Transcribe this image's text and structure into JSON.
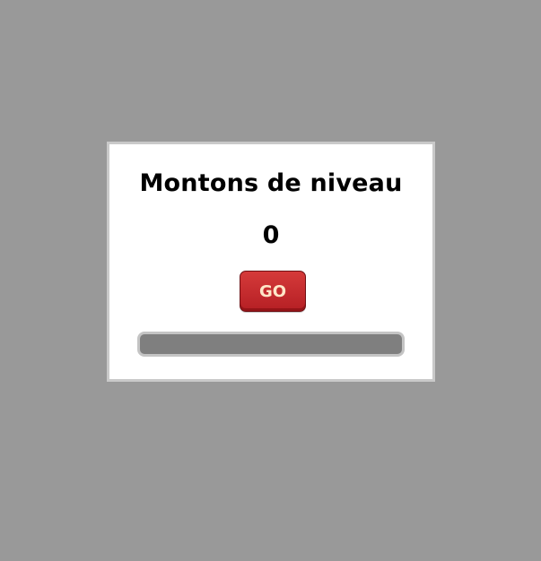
{
  "panel": {
    "title": "Montons de niveau",
    "counter": "0",
    "go_label": "GO",
    "progress_fraction": 0
  },
  "colors": {
    "background": "#999999",
    "panel": "#ffffff",
    "button": "#c9302c",
    "button_text": "#ffe6c8",
    "progress_track": "#7f7f7f"
  }
}
